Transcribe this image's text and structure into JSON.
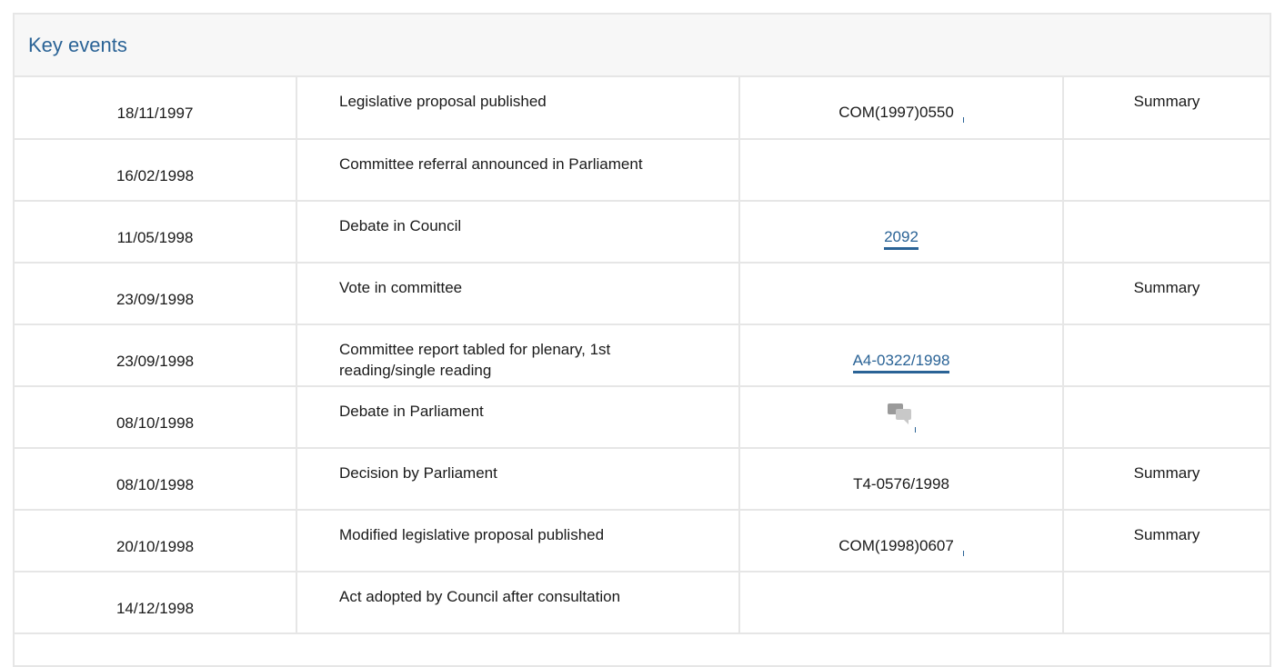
{
  "panel": {
    "title": "Key events"
  },
  "events": [
    {
      "date": "18/11/1997",
      "event": "Legislative proposal published",
      "doc": "COM(1997)0550",
      "doc_type": "plain",
      "summary": "Summary"
    },
    {
      "date": "16/02/1998",
      "event": "Committee referral announced in Parliament",
      "doc": "",
      "doc_type": "none",
      "summary": ""
    },
    {
      "date": "11/05/1998",
      "event": "Debate in Council",
      "doc": "2092",
      "doc_type": "link",
      "summary": ""
    },
    {
      "date": "23/09/1998",
      "event": "Vote in committee",
      "doc": "",
      "doc_type": "none",
      "summary": "Summary"
    },
    {
      "date": "23/09/1998",
      "event": "Committee report tabled for plenary, 1st reading/single reading",
      "doc": "A4-0322/1998",
      "doc_type": "link",
      "summary": ""
    },
    {
      "date": "08/10/1998",
      "event": "Debate in Parliament",
      "doc": "",
      "doc_type": "icon",
      "doc_icon": "debate-speech-bubbles-icon",
      "summary": ""
    },
    {
      "date": "08/10/1998",
      "event": "Decision by Parliament",
      "doc": "T4-0576/1998",
      "doc_type": "text",
      "summary": "Summary"
    },
    {
      "date": "20/10/1998",
      "event": "Modified legislative proposal published",
      "doc": "COM(1998)0607",
      "doc_type": "plain",
      "summary": "Summary"
    },
    {
      "date": "14/12/1998",
      "event": "Act adopted by Council after consultation",
      "doc": "",
      "doc_type": "none",
      "summary": ""
    }
  ],
  "colors": {
    "title": "#2a6396",
    "link": "#2a6396",
    "border": "#e6e6e6",
    "header_bg": "#f7f7f7"
  }
}
